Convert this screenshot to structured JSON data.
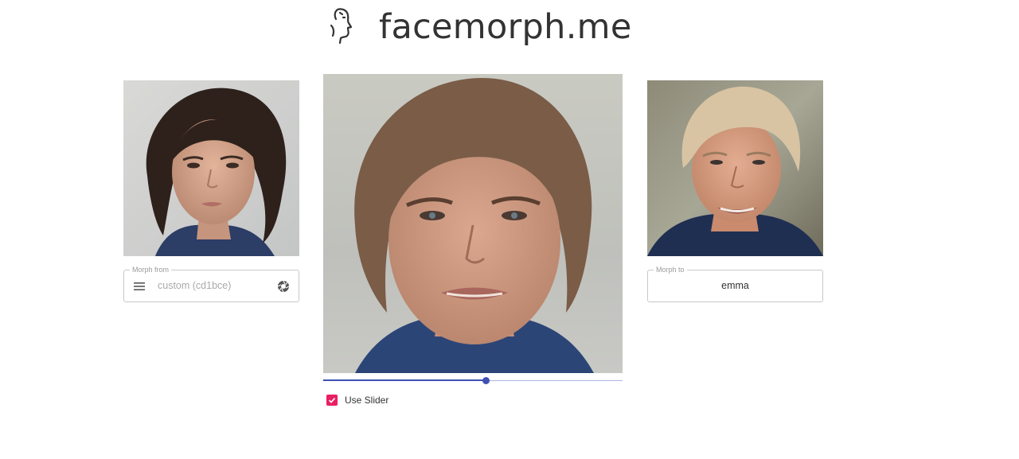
{
  "header": {
    "brand": "facemorph.me",
    "logo_icon": "face-profile-icon"
  },
  "morph_from": {
    "label": "Morph from",
    "placeholder": "custom (cd1bce)",
    "menu_icon": "menu-icon",
    "camera_icon": "camera-shutter-icon"
  },
  "morph_to": {
    "label": "Morph to",
    "value": "emma"
  },
  "slider": {
    "value_fraction": 0.543,
    "accent_color": "#3f51b5"
  },
  "use_slider": {
    "label": "Use Slider",
    "checked": true,
    "color": "#e91e63"
  }
}
